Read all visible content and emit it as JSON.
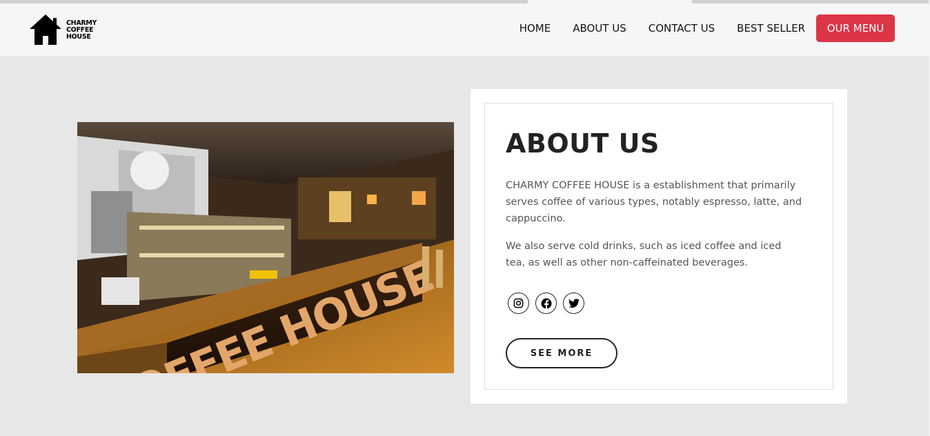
{
  "brand": {
    "logo_lines": [
      "CHARMY",
      "COFFEE",
      "HOUSE"
    ],
    "logo_icon": "house-icon"
  },
  "nav": {
    "links": [
      "HOME",
      "ABOUT US",
      "CONTACT US",
      "BEST SELLER"
    ],
    "menu_button": "OUR MENU",
    "accent_color": "#dc3545"
  },
  "hero_photo": {
    "sign_text": "COFFEE HOUSE"
  },
  "about": {
    "title": "ABOUT US",
    "paragraph_1": "CHARMY COFFEE HOUSE is a establishment that primarily serves coffee of various types, notably espresso, latte, and cappuccino.",
    "paragraph_2": "We also serve cold drinks, such as iced coffee and iced tea, as well as other non-caffeinated beverages.",
    "socials": [
      "instagram-icon",
      "facebook-icon",
      "twitter-icon"
    ],
    "see_more": "SEE MORE"
  }
}
